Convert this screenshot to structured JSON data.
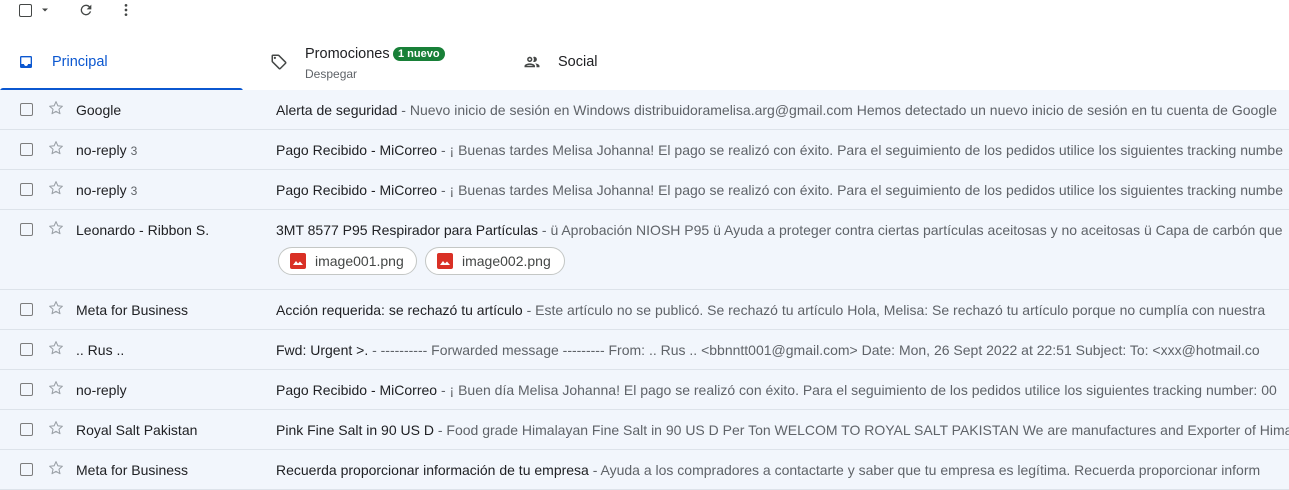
{
  "toolbar": {
    "select_icon": "checkbox-icon",
    "dropdown_icon": "chevron-down-icon",
    "refresh_icon": "refresh-icon",
    "more_icon": "more-vertical-icon"
  },
  "tabs": [
    {
      "label": "Principal",
      "icon": "inbox-icon",
      "active": true
    },
    {
      "label": "Promociones",
      "icon": "tag-icon",
      "badge": "1 nuevo",
      "sub": "Despegar"
    },
    {
      "label": "Social",
      "icon": "people-icon"
    }
  ],
  "emails": [
    {
      "sender": "Google",
      "count": "",
      "subject": "Alerta de seguridad",
      "snippet": " - Nuevo inicio de sesión en Windows distribuidoramelisa.arg@gmail.com Hemos detectado un nuevo inicio de sesión en tu cuenta de Google"
    },
    {
      "sender": "no-reply",
      "count": "3",
      "subject": "Pago Recibido - MiCorreo",
      "snippet": " - ¡ Buenas tardes Melisa Johanna! El pago se realizó con éxito. Para el seguimiento de los pedidos utilice los siguientes tracking numbe"
    },
    {
      "sender": "no-reply",
      "count": "3",
      "subject": "Pago Recibido - MiCorreo",
      "snippet": " - ¡ Buenas tardes Melisa Johanna! El pago se realizó con éxito. Para el seguimiento de los pedidos utilice los siguientes tracking numbe"
    },
    {
      "sender": "Leonardo - Ribbon S.",
      "count": "",
      "subject": "3MT 8577 P95 Respirador para Partículas",
      "snippet": " - ü Aprobación NIOSH P95 ü Ayuda a proteger contra ciertas partículas aceitosas y no aceitosas ü Capa de carbón que",
      "attachments": [
        "image001.png",
        "image002.png"
      ]
    },
    {
      "sender": "Meta for Business",
      "count": "",
      "subject": "Acción requerida: se rechazó tu artículo",
      "snippet": " - Este artículo no se publicó.  Se rechazó tu artículo Hola, Melisa: Se rechazó tu artículo porque no cumplía con nuestra"
    },
    {
      "sender": ".. Rus ..",
      "count": "",
      "subject": "Fwd: Urgent >.",
      "snippet": " - ---------- Forwarded message --------- From: .. Rus .. <bbnntt001@gmail.com> Date: Mon, 26 Sept 2022 at 22:51 Subject: To: <xxx@hotmail.co"
    },
    {
      "sender": "no-reply",
      "count": "",
      "subject": "Pago Recibido - MiCorreo",
      "snippet": " - ¡ Buen día Melisa Johanna! El pago se realizó con éxito. Para el seguimiento de los pedidos utilice los siguientes tracking number: 00"
    },
    {
      "sender": "Royal Salt Pakistan",
      "count": "",
      "subject": "Pink Fine Salt in 90 US D",
      "snippet": " - Food grade Himalayan Fine Salt in 90 US D Per Ton WELCOM TO ROYAL SALT PAKISTAN We are manufactures and Exporter of Himalay"
    },
    {
      "sender": "Meta for Business",
      "count": "",
      "subject": "Recuerda proporcionar información de tu empresa",
      "snippet": " - Ayuda a los compradores a contactarte y saber que tu empresa es legítima.  Recuerda proporcionar inform"
    }
  ],
  "colors": {
    "accent": "#0b57d0",
    "badge": "#188038",
    "row_bg": "#f2f6fc",
    "attachment_icon": "#d93025"
  }
}
